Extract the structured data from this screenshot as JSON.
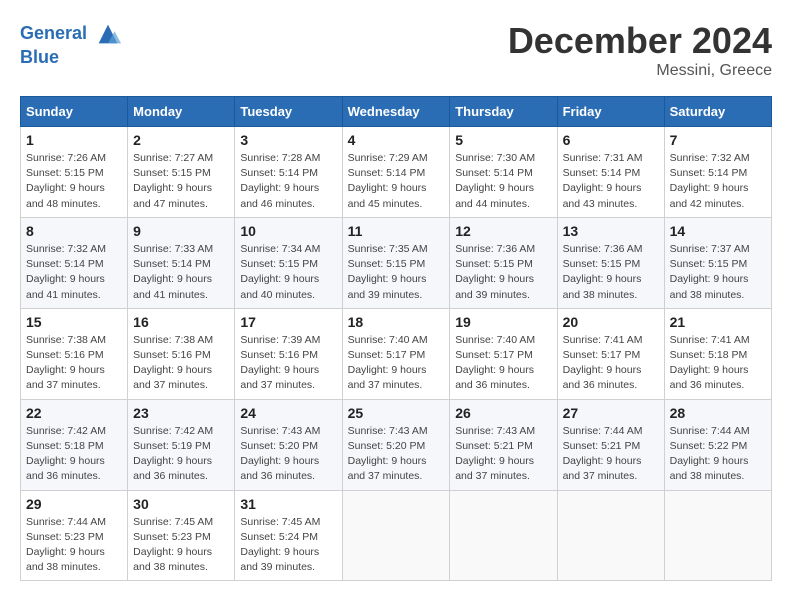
{
  "header": {
    "logo_line1": "General",
    "logo_line2": "Blue",
    "month": "December 2024",
    "location": "Messini, Greece"
  },
  "weekdays": [
    "Sunday",
    "Monday",
    "Tuesday",
    "Wednesday",
    "Thursday",
    "Friday",
    "Saturday"
  ],
  "weeks": [
    [
      {
        "day": "1",
        "sunrise": "7:26 AM",
        "sunset": "5:15 PM",
        "daylight": "9 hours and 48 minutes."
      },
      {
        "day": "2",
        "sunrise": "7:27 AM",
        "sunset": "5:15 PM",
        "daylight": "9 hours and 47 minutes."
      },
      {
        "day": "3",
        "sunrise": "7:28 AM",
        "sunset": "5:14 PM",
        "daylight": "9 hours and 46 minutes."
      },
      {
        "day": "4",
        "sunrise": "7:29 AM",
        "sunset": "5:14 PM",
        "daylight": "9 hours and 45 minutes."
      },
      {
        "day": "5",
        "sunrise": "7:30 AM",
        "sunset": "5:14 PM",
        "daylight": "9 hours and 44 minutes."
      },
      {
        "day": "6",
        "sunrise": "7:31 AM",
        "sunset": "5:14 PM",
        "daylight": "9 hours and 43 minutes."
      },
      {
        "day": "7",
        "sunrise": "7:32 AM",
        "sunset": "5:14 PM",
        "daylight": "9 hours and 42 minutes."
      }
    ],
    [
      {
        "day": "8",
        "sunrise": "7:32 AM",
        "sunset": "5:14 PM",
        "daylight": "9 hours and 41 minutes."
      },
      {
        "day": "9",
        "sunrise": "7:33 AM",
        "sunset": "5:14 PM",
        "daylight": "9 hours and 41 minutes."
      },
      {
        "day": "10",
        "sunrise": "7:34 AM",
        "sunset": "5:15 PM",
        "daylight": "9 hours and 40 minutes."
      },
      {
        "day": "11",
        "sunrise": "7:35 AM",
        "sunset": "5:15 PM",
        "daylight": "9 hours and 39 minutes."
      },
      {
        "day": "12",
        "sunrise": "7:36 AM",
        "sunset": "5:15 PM",
        "daylight": "9 hours and 39 minutes."
      },
      {
        "day": "13",
        "sunrise": "7:36 AM",
        "sunset": "5:15 PM",
        "daylight": "9 hours and 38 minutes."
      },
      {
        "day": "14",
        "sunrise": "7:37 AM",
        "sunset": "5:15 PM",
        "daylight": "9 hours and 38 minutes."
      }
    ],
    [
      {
        "day": "15",
        "sunrise": "7:38 AM",
        "sunset": "5:16 PM",
        "daylight": "9 hours and 37 minutes."
      },
      {
        "day": "16",
        "sunrise": "7:38 AM",
        "sunset": "5:16 PM",
        "daylight": "9 hours and 37 minutes."
      },
      {
        "day": "17",
        "sunrise": "7:39 AM",
        "sunset": "5:16 PM",
        "daylight": "9 hours and 37 minutes."
      },
      {
        "day": "18",
        "sunrise": "7:40 AM",
        "sunset": "5:17 PM",
        "daylight": "9 hours and 37 minutes."
      },
      {
        "day": "19",
        "sunrise": "7:40 AM",
        "sunset": "5:17 PM",
        "daylight": "9 hours and 36 minutes."
      },
      {
        "day": "20",
        "sunrise": "7:41 AM",
        "sunset": "5:17 PM",
        "daylight": "9 hours and 36 minutes."
      },
      {
        "day": "21",
        "sunrise": "7:41 AM",
        "sunset": "5:18 PM",
        "daylight": "9 hours and 36 minutes."
      }
    ],
    [
      {
        "day": "22",
        "sunrise": "7:42 AM",
        "sunset": "5:18 PM",
        "daylight": "9 hours and 36 minutes."
      },
      {
        "day": "23",
        "sunrise": "7:42 AM",
        "sunset": "5:19 PM",
        "daylight": "9 hours and 36 minutes."
      },
      {
        "day": "24",
        "sunrise": "7:43 AM",
        "sunset": "5:20 PM",
        "daylight": "9 hours and 36 minutes."
      },
      {
        "day": "25",
        "sunrise": "7:43 AM",
        "sunset": "5:20 PM",
        "daylight": "9 hours and 37 minutes."
      },
      {
        "day": "26",
        "sunrise": "7:43 AM",
        "sunset": "5:21 PM",
        "daylight": "9 hours and 37 minutes."
      },
      {
        "day": "27",
        "sunrise": "7:44 AM",
        "sunset": "5:21 PM",
        "daylight": "9 hours and 37 minutes."
      },
      {
        "day": "28",
        "sunrise": "7:44 AM",
        "sunset": "5:22 PM",
        "daylight": "9 hours and 38 minutes."
      }
    ],
    [
      {
        "day": "29",
        "sunrise": "7:44 AM",
        "sunset": "5:23 PM",
        "daylight": "9 hours and 38 minutes."
      },
      {
        "day": "30",
        "sunrise": "7:45 AM",
        "sunset": "5:23 PM",
        "daylight": "9 hours and 38 minutes."
      },
      {
        "day": "31",
        "sunrise": "7:45 AM",
        "sunset": "5:24 PM",
        "daylight": "9 hours and 39 minutes."
      },
      null,
      null,
      null,
      null
    ]
  ],
  "labels": {
    "sunrise": "Sunrise: ",
    "sunset": "Sunset: ",
    "daylight": "Daylight: "
  }
}
